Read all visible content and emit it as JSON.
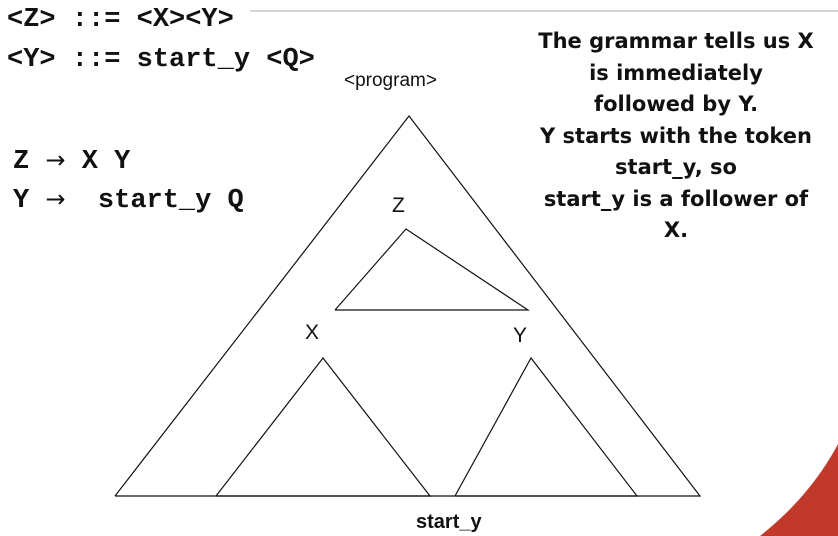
{
  "grammar": {
    "line1": "<Z> ::= <X><Y>",
    "line2": "<Y> ::= start_y <Q>"
  },
  "productions": [
    {
      "lhs": "Z",
      "arrow": "→",
      "rhs": "X Y"
    },
    {
      "lhs": "Y",
      "arrow": "→",
      "rhs": "start_y Q"
    }
  ],
  "tree": {
    "root": "<program>",
    "node_z": "Z",
    "node_x": "X",
    "node_y": "Y",
    "leaf_token": "start_y"
  },
  "explanation": [
    "The grammar tells us X",
    "is immediately",
    "followed by Y.",
    "Y starts with the token",
    "start_y, so",
    "start_y is a follower of",
    "X."
  ],
  "colors": {
    "accent": "#c0392b",
    "rule": "#d6d6d6"
  }
}
